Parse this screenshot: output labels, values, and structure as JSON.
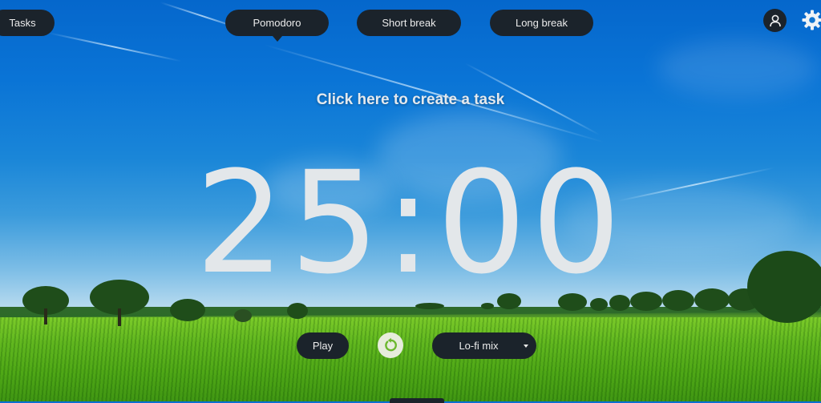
{
  "nav": {
    "tasks_label": "Tasks",
    "modes": [
      {
        "label": "Pomodoro",
        "active": true
      },
      {
        "label": "Short break",
        "active": false
      },
      {
        "label": "Long break",
        "active": false
      }
    ],
    "account_icon": "user-icon",
    "settings_icon": "gear-icon"
  },
  "main": {
    "create_task_prompt": "Click here to create a task",
    "timer": "25:00"
  },
  "controls": {
    "play_label": "Play",
    "reset_icon": "reset-icon",
    "music_select": {
      "selected": "Lo-fi mix"
    }
  },
  "colors": {
    "pill_bg": "#1b232b",
    "pill_text": "#ececec",
    "timer_text": "#e3e7ea",
    "reset_bg": "#e7ecdc",
    "reset_icon": "#6cb82e"
  }
}
